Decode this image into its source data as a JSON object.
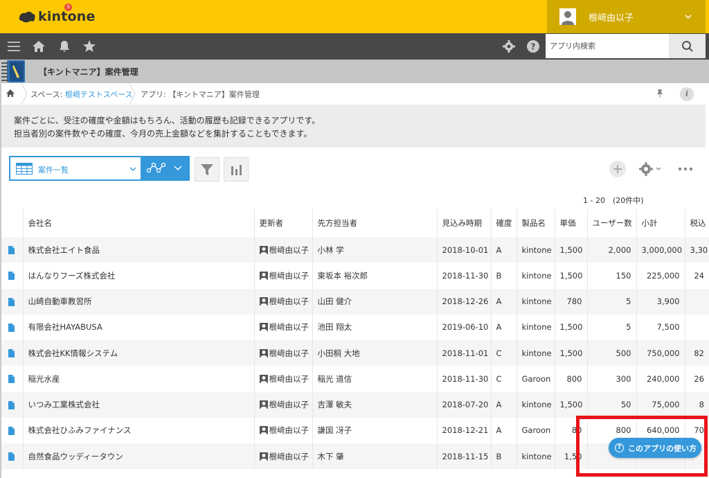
{
  "brand": {
    "name": "kintone"
  },
  "user": {
    "name": "根﨑由以子"
  },
  "nav": {
    "notification_count": "3"
  },
  "search": {
    "placeholder": "アプリ内検索"
  },
  "app": {
    "title": "【キントマニア】案件管理"
  },
  "breadcrumb": {
    "space_prefix": "スペース: ",
    "space_name": "根﨑テストスペース",
    "app_label": "アプリ: 【キントマニア】案件管理"
  },
  "description": {
    "line1": "案件ごとに、受注の確度や金額はもちろん、活動の履歴も記録できるアプリです。",
    "line2": "担当者別の案件数やその確度、今月の売上金額などを集計することもできます。"
  },
  "toolbar": {
    "view_name": "案件一覧"
  },
  "pager": {
    "text": "1 - 20　(20件中)"
  },
  "table": {
    "headers": [
      "会社名",
      "更新者",
      "先方担当者",
      "見込み時期",
      "確度",
      "製品名",
      "単価",
      "ユーザー数",
      "小計",
      "税込"
    ],
    "rows": [
      {
        "company": "株式会社エイト食品",
        "updater": "根﨑由以子",
        "contact": "小林 学",
        "date": "2018-10-01",
        "rank": "A",
        "product": "kintone",
        "price": "1,500",
        "users": "2,000",
        "subtotal": "3,000,000",
        "tax": "3,30"
      },
      {
        "company": "はんなりフーズ株式会社",
        "updater": "根﨑由以子",
        "contact": "東坂本 裕次郎",
        "date": "2018-11-30",
        "rank": "B",
        "product": "kintone",
        "price": "1,500",
        "users": "150",
        "subtotal": "225,000",
        "tax": "24"
      },
      {
        "company": "山崎自動車教習所",
        "updater": "根﨑由以子",
        "contact": "山田 健介",
        "date": "2018-12-26",
        "rank": "A",
        "product": "kintone",
        "price": "780",
        "users": "5",
        "subtotal": "3,900",
        "tax": ""
      },
      {
        "company": "有限会社HAYABUSA",
        "updater": "根﨑由以子",
        "contact": "池田 翔太",
        "date": "2019-06-10",
        "rank": "A",
        "product": "kintone",
        "price": "1,500",
        "users": "5",
        "subtotal": "7,500",
        "tax": ""
      },
      {
        "company": "株式会社KK情報システム",
        "updater": "根﨑由以子",
        "contact": "小田桐 大地",
        "date": "2018-11-01",
        "rank": "C",
        "product": "kintone",
        "price": "1,500",
        "users": "500",
        "subtotal": "750,000",
        "tax": "82"
      },
      {
        "company": "稲光水産",
        "updater": "根﨑由以子",
        "contact": "稲光 道信",
        "date": "2018-11-30",
        "rank": "C",
        "product": "Garoon",
        "price": "800",
        "users": "300",
        "subtotal": "240,000",
        "tax": "26"
      },
      {
        "company": "いつみ工業株式会社",
        "updater": "根﨑由以子",
        "contact": "吉澤 敏夫",
        "date": "2018-07-20",
        "rank": "A",
        "product": "kintone",
        "price": "1,500",
        "users": "50",
        "subtotal": "75,000",
        "tax": "8"
      },
      {
        "company": "株式会社ひふみファイナンス",
        "updater": "根﨑由以子",
        "contact": "謙国 冴子",
        "date": "2018-12-21",
        "rank": "A",
        "product": "Garoon",
        "price": "80",
        "users": "800",
        "subtotal": "640,000",
        "tax": "70"
      },
      {
        "company": "自然食品ウッディータウン",
        "updater": "根﨑由以子",
        "contact": "木下 肇",
        "date": "2018-11-15",
        "rank": "B",
        "product": "kintone",
        "price": "1,50",
        "users": "",
        "subtotal": "",
        "tax": ""
      }
    ]
  },
  "help": {
    "label": "このアプリの使い方"
  },
  "colors": {
    "yellow": "#fcc800",
    "dark_nav": "#484848",
    "accent_blue": "#3498db",
    "highlight_red": "#e8141a"
  }
}
